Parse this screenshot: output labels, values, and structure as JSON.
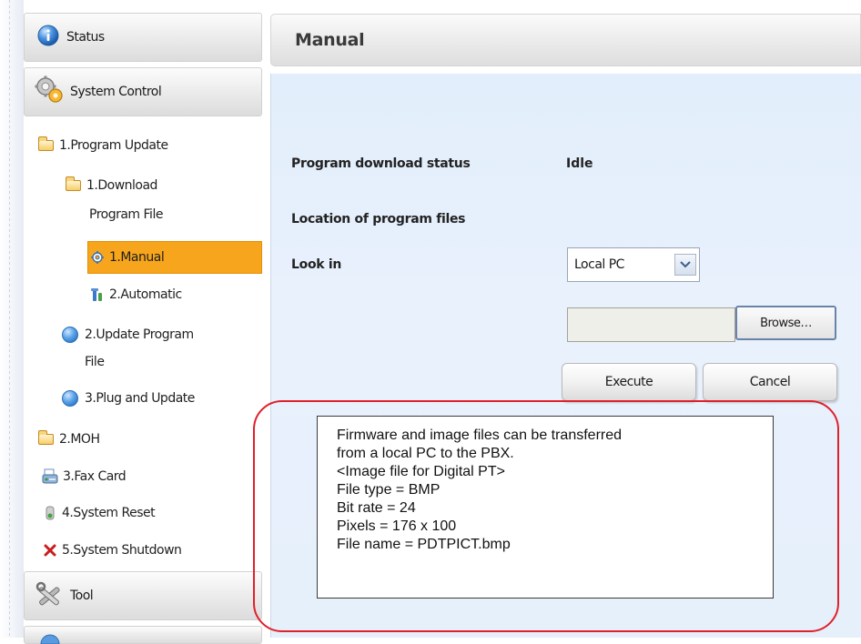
{
  "sidebar": {
    "status": "Status",
    "system_control": "System Control",
    "tool": "Tool",
    "items": [
      {
        "label": "1.Program Update",
        "icon": "folder-icon"
      },
      {
        "label": "1.Download",
        "icon": "folder-icon"
      },
      {
        "label": "Program File"
      },
      {
        "label": "1.Manual",
        "icon": "gear-icon",
        "selected": true
      },
      {
        "label": "2.Automatic",
        "icon": "tool-icon"
      },
      {
        "label": "2.Update Program",
        "icon": "globe-icon"
      },
      {
        "label": "File"
      },
      {
        "label": "3.Plug and Update",
        "icon": "globe-icon"
      },
      {
        "label": "2.MOH",
        "icon": "folder-icon"
      },
      {
        "label": "3.Fax Card",
        "icon": "fax-icon"
      },
      {
        "label": "4.System Reset",
        "icon": "reset-icon"
      },
      {
        "label": "5.System Shutdown",
        "icon": "shutdown-icon"
      }
    ]
  },
  "main": {
    "title": "Manual",
    "download_status_label": "Program download status",
    "download_status_value": "Idle",
    "location_label": "Location of program files",
    "look_in_label": "Look in",
    "look_in_value": "Local PC",
    "browse_label": "Browse…",
    "execute_label": "Execute",
    "cancel_label": "Cancel"
  },
  "note": {
    "lines": [
      "Firmware and image files can be transferred",
      "from a local PC to the PBX.",
      "<Image file for Digital PT>",
      "File type = BMP",
      "Bit rate = 24",
      "Pixels = 176 x 100",
      "File name = PDTPICT.bmp"
    ]
  },
  "colors": {
    "selected": "#f7a51c",
    "callout": "#e0202a",
    "panel": "#e6f0fb"
  }
}
